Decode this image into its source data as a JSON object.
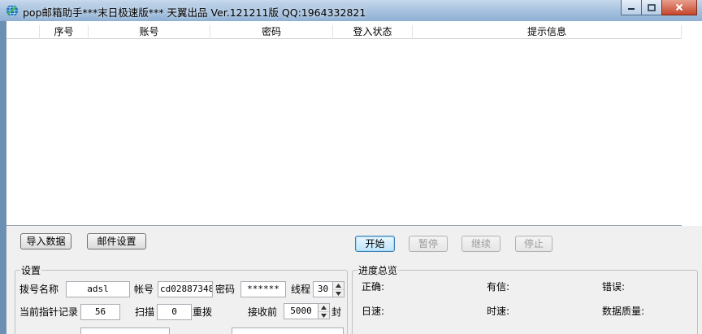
{
  "window": {
    "title": "pop邮箱助手***末日极速版*** 天翼出品 Ver.121211版   QQ:1964332821"
  },
  "grid": {
    "columns": [
      "",
      "序号",
      "账号",
      "密码",
      "登入状态",
      "提示信息"
    ]
  },
  "buttons": {
    "import": "导入数据",
    "mail_settings": "邮件设置",
    "start": "开始",
    "pause": "暂停",
    "resume": "继续",
    "stop": "停止"
  },
  "settings": {
    "legend": "设置",
    "dial_name_label": "拨号名称",
    "dial_name_value": "adsl",
    "account_label": "帐号",
    "account_value": "cd02887348",
    "password_label": "密码",
    "password_value": "******",
    "threads_label": "线程",
    "threads_value": "30",
    "pointer_label": "当前指针记录",
    "pointer_value": "56",
    "scan_label": "扫描",
    "scan_value": "0",
    "redial_label": "重拨",
    "receive_label": "接收前",
    "receive_value": "5000",
    "receive_unit": "封"
  },
  "progress": {
    "legend": "进度总览",
    "correct_label": "正确:",
    "has_mail_label": "有信:",
    "error_label": "错误:",
    "daily_speed_label": "日速:",
    "hourly_speed_label": "时速:",
    "quality_label": "数据质量:"
  }
}
